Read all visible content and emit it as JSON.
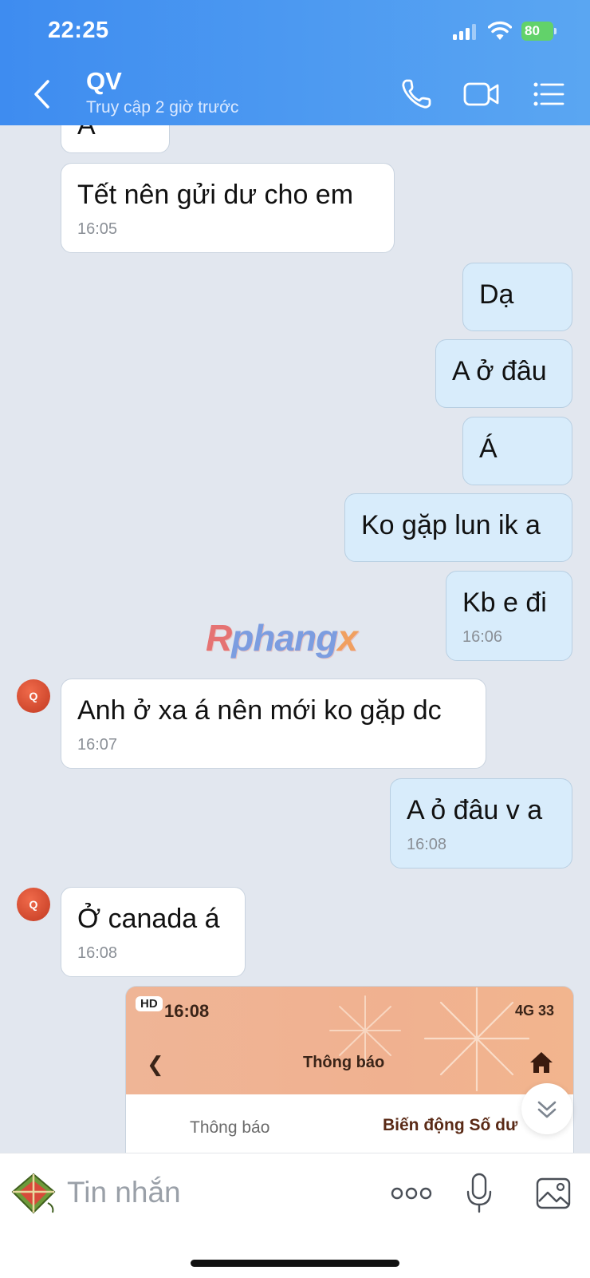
{
  "status_bar": {
    "time": "22:25",
    "battery": "80"
  },
  "header": {
    "title": "QV",
    "subtitle": "Truy cập 2 giờ trước"
  },
  "avatar_initial": "Q",
  "messages": [
    {
      "direction": "in",
      "text": "A",
      "time": ""
    },
    {
      "direction": "in",
      "text": "Tết nên gửi dư cho em",
      "time": "16:05"
    },
    {
      "direction": "out",
      "text": "Dạ",
      "time": ""
    },
    {
      "direction": "out",
      "text": "A ở đâu",
      "time": ""
    },
    {
      "direction": "out",
      "text": "Á",
      "time": ""
    },
    {
      "direction": "out",
      "text": "Ko gặp lun ik a",
      "time": ""
    },
    {
      "direction": "out",
      "text": "Kb e đi",
      "time": "16:06"
    },
    {
      "direction": "in",
      "text": "Anh ở xa á nên mới ko gặp dc",
      "time": "16:07"
    },
    {
      "direction": "out",
      "text": "A ỏ đâu v a",
      "time": "16:08"
    },
    {
      "direction": "in",
      "text": "Ở canada á",
      "time": "16:08"
    }
  ],
  "watermark": {
    "p1": "R",
    "p2": "phang",
    "p3": "x"
  },
  "image_message": {
    "hd_badge": "HD",
    "screenshot_time": "16:08",
    "network": "4G",
    "battery": "33",
    "screen_title": "Thông báo",
    "tab_1": "Thông báo",
    "tab_2": "Biến động Số dư"
  },
  "input": {
    "placeholder": "Tin nhắn"
  },
  "colors": {
    "header_start": "#3e8cf0",
    "header_end": "#5aa6f2",
    "outgoing_bubble": "#d8ecfb",
    "incoming_bubble": "#ffffff",
    "background": "#e2e7ef"
  },
  "icons": [
    "back-chevron-icon",
    "phone-icon",
    "video-icon",
    "list-menu-icon",
    "scroll-down-icon",
    "sticker-icon",
    "more-icon",
    "microphone-icon",
    "gallery-icon"
  ]
}
